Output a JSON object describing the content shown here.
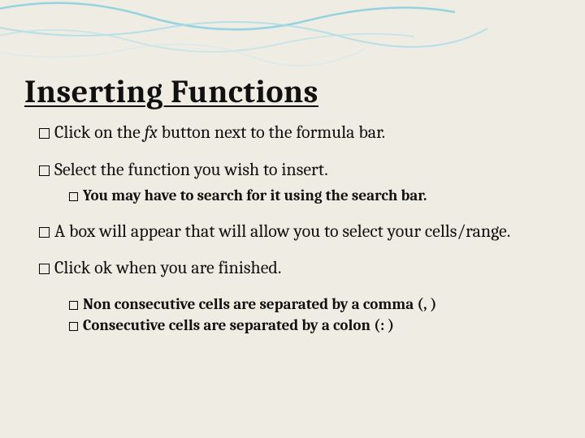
{
  "title": "Inserting Functions",
  "bullets": {
    "b1_pre": "Click on the ",
    "b1_fx": "fx",
    "b1_post": " button next to the formula bar.",
    "b2": "Select the function you wish to insert.",
    "b2_sub": "You  may have to search for it using the search bar.",
    "b3": "A box will appear that will allow you to select your cells/range.",
    "b4": "Click ok when you are finished.",
    "b4_sub1": "Non consecutive cells are separated by a comma (, )",
    "b4_sub2": "Consecutive cells are separated by a colon (: )"
  }
}
